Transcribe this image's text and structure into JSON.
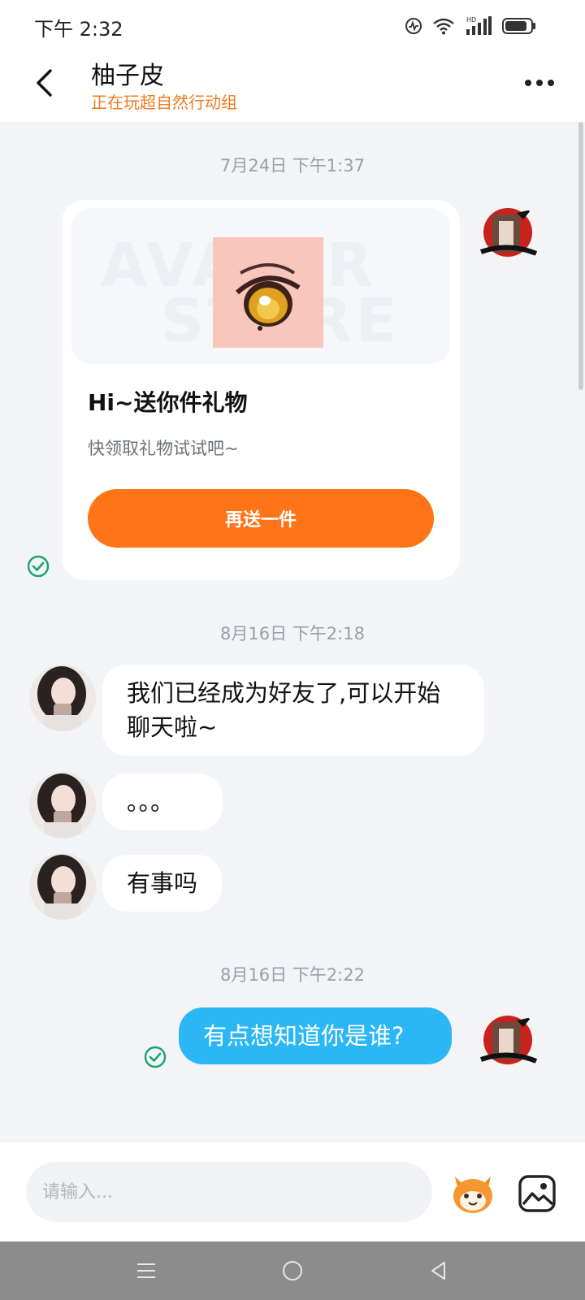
{
  "status_bar": {
    "time": "下午 2:32",
    "icons": [
      "activity-icon",
      "wifi-icon",
      "hd-signal-icon",
      "battery-icon"
    ]
  },
  "header": {
    "contact_name": "柚子皮",
    "status_text": "正在玩超自然行动组",
    "icons": [
      "back-arrow-icon",
      "more-dots-icon"
    ]
  },
  "messages": {
    "ts1": "7月24日 下午1:37",
    "gift": {
      "banner_watermark_1": "AVATAR",
      "banner_watermark_2": "STORE",
      "title": "Hi~送你件礼物",
      "description": "快领取礼物试试吧~",
      "button": "再送一件"
    },
    "ts2": "8月16日 下午2:18",
    "msg1": "我们已经成为好友了,可以开始聊天啦~",
    "msg2": "。。。",
    "msg3": "有事吗",
    "ts3": "8月16日 下午2:22",
    "msg4": "有点想知道你是谁?"
  },
  "input_bar": {
    "placeholder": "请输入...",
    "icons": [
      "emoji-mascot-icon",
      "image-picker-icon"
    ]
  },
  "nav_bar": {
    "icons": [
      "menu-icon",
      "home-icon",
      "back-icon"
    ]
  },
  "colors": {
    "accent_orange": "#ff7417",
    "status_orange": "#f07a1c",
    "my_bubble_blue": "#2bb6f5",
    "sent_check_green": "#1aa36b",
    "chat_background": "#f2f4f7"
  }
}
